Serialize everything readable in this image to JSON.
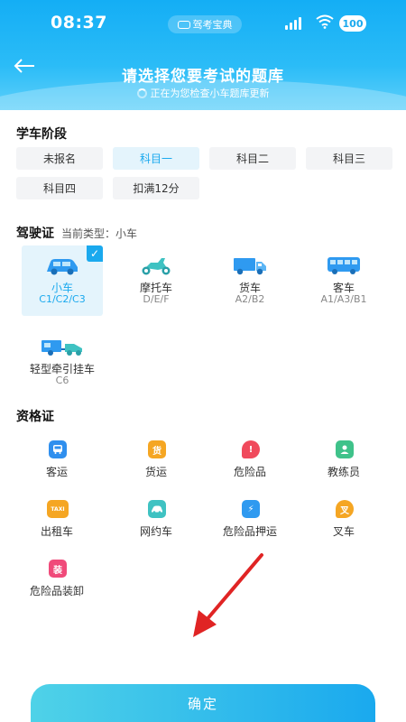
{
  "status_bar": {
    "time": "08:37",
    "app_pill": "驾考宝典",
    "battery": "100"
  },
  "header": {
    "title": "请选择您要考试的题库",
    "update_status": "正在为您检查小车题库更新"
  },
  "study_stage": {
    "title": "学车阶段",
    "options": [
      "未报名",
      "科目一",
      "科目二",
      "科目三",
      "科目四",
      "扣满12分"
    ],
    "selected": "科目一"
  },
  "license": {
    "title": "驾驶证",
    "current_type_label": "当前类型：小车",
    "vehicles": [
      {
        "name": "小车",
        "code": "C1/C2/C3",
        "icon": "car-icon",
        "selected": true
      },
      {
        "name": "摩托车",
        "code": "D/E/F",
        "icon": "motorcycle-icon",
        "selected": false
      },
      {
        "name": "货车",
        "code": "A2/B2",
        "icon": "truck-icon",
        "selected": false
      },
      {
        "name": "客车",
        "code": "A1/A3/B1",
        "icon": "bus-icon",
        "selected": false
      },
      {
        "name": "轻型牵引挂车",
        "code": "C6",
        "icon": "trailer-icon",
        "selected": false
      }
    ]
  },
  "qualification": {
    "title": "资格证",
    "items": [
      {
        "name": "客运",
        "icon": "bus-icon",
        "glyph": "",
        "color": "#2f8fee"
      },
      {
        "name": "货运",
        "icon": "cargo-icon",
        "glyph": "货",
        "color": "#f5a623"
      },
      {
        "name": "危险品",
        "icon": "hazard-icon",
        "glyph": "!",
        "color": "#f04a5c"
      },
      {
        "name": "教练员",
        "icon": "coach-icon",
        "glyph": "",
        "color": "#3fc28a"
      },
      {
        "name": "出租车",
        "icon": "taxi-icon",
        "glyph": "TAXI",
        "color": "#f5a623"
      },
      {
        "name": "网约车",
        "icon": "ride-hailing-icon",
        "glyph": "",
        "color": "#3fc2c2"
      },
      {
        "name": "危险品押运",
        "icon": "escort-icon",
        "glyph": "⚡",
        "color": "#2f9af0"
      },
      {
        "name": "叉车",
        "icon": "forklift-icon",
        "glyph": "叉",
        "color": "#f5a623"
      },
      {
        "name": "危险品装卸",
        "icon": "loading-icon",
        "glyph": "装",
        "color": "#f04a7a"
      }
    ]
  },
  "confirm_label": "确定",
  "colors": {
    "accent": "#1aa9ee",
    "selected_bg": "#e4f4fc"
  }
}
